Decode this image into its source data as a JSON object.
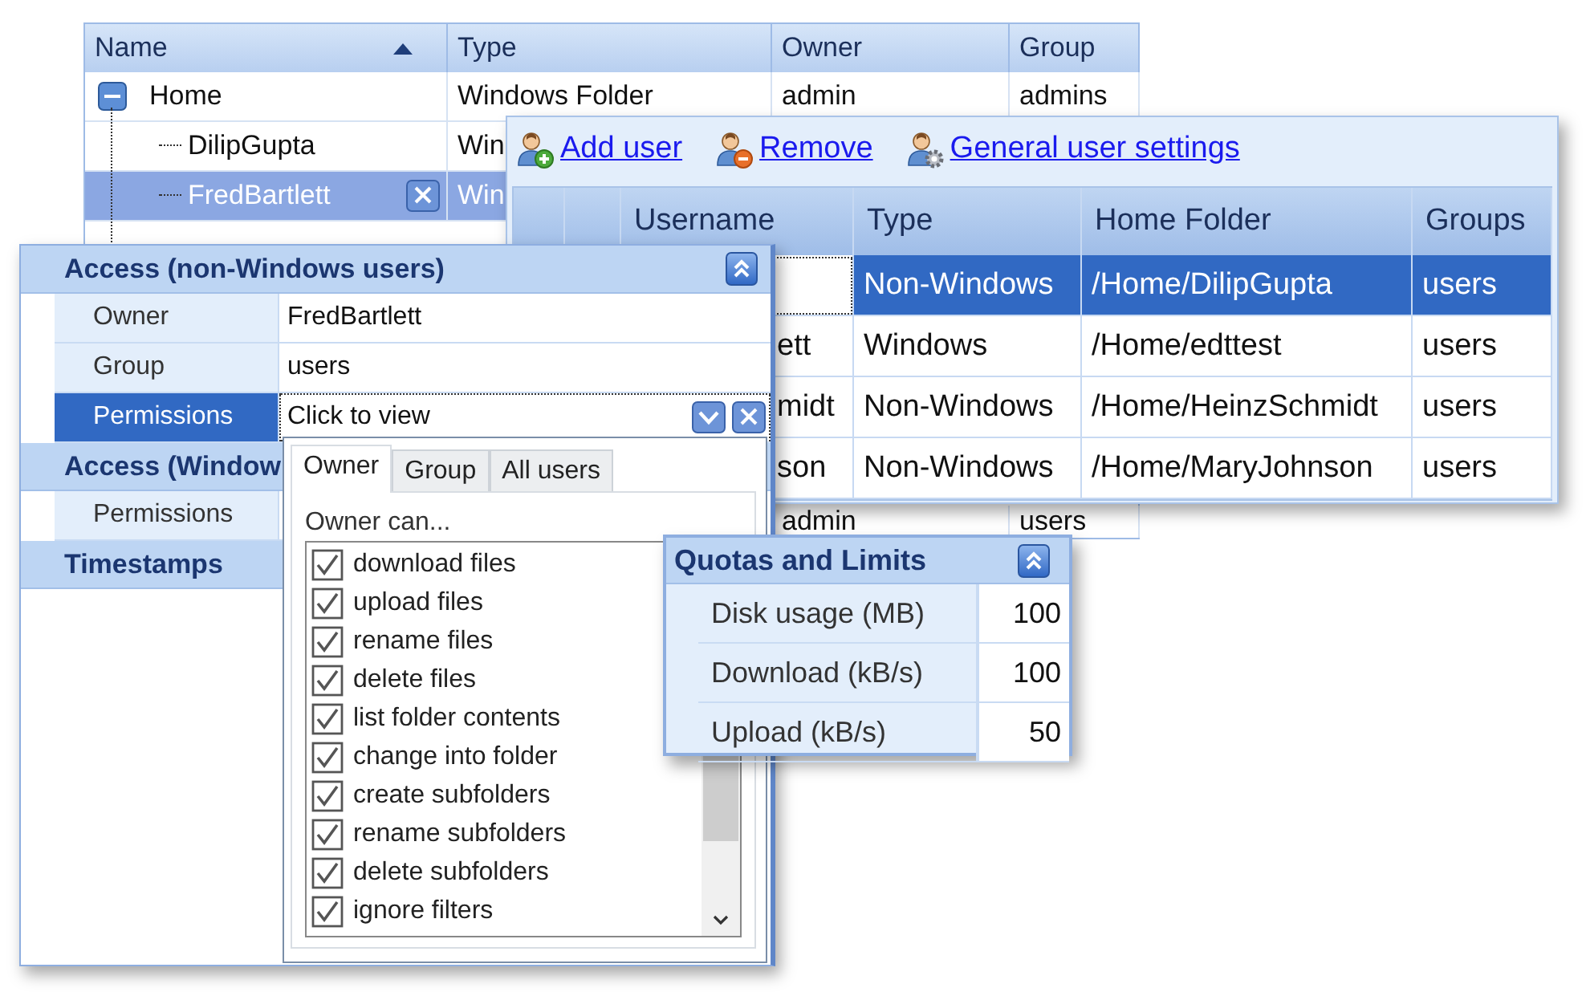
{
  "tree_grid": {
    "columns": [
      {
        "label": "Name",
        "sorted": true
      },
      {
        "label": "Type",
        "sorted": false
      },
      {
        "label": "Owner",
        "sorted": false
      },
      {
        "label": "Group",
        "sorted": false
      }
    ],
    "rows": [
      {
        "name": "Home",
        "type": "Windows Folder",
        "owner": "admin",
        "group": "admins",
        "expanded": true,
        "selected": false,
        "children": [
          {
            "name": "DilipGupta",
            "type": "Win",
            "selected": false
          },
          {
            "name": "FredBartlett",
            "type": "Win",
            "selected": true
          }
        ]
      }
    ],
    "lower_row": {
      "owner": "admin",
      "group": "users"
    }
  },
  "user_manager": {
    "toolbar": [
      {
        "label": "Add user",
        "kind": "add"
      },
      {
        "label": "Remove",
        "kind": "remove"
      },
      {
        "label": "General user settings",
        "kind": "settings"
      }
    ],
    "columns": [
      "Username",
      "Type",
      "Home Folder",
      "Groups"
    ],
    "rows": [
      {
        "type": "Non-Windows",
        "home_folder": "/Home/DilipGupta",
        "groups": "users",
        "selected": true
      },
      {
        "username": "ett",
        "type": "Windows",
        "home_folder": "/Home/edttest",
        "groups": "users",
        "selected": false
      },
      {
        "username": "midt",
        "type": "Non-Windows",
        "home_folder": "/Home/HeinzSchmidt",
        "groups": "users",
        "selected": false
      },
      {
        "username": "son",
        "type": "Non-Windows",
        "home_folder": "/Home/MaryJohnson",
        "groups": "users",
        "selected": false
      }
    ]
  },
  "properties": {
    "categories": [
      {
        "title": "Access (non-Windows users)",
        "expanded": true,
        "rows": [
          {
            "label": "Owner",
            "value": "FredBartlett",
            "kind": "text",
            "selected": false
          },
          {
            "label": "Group",
            "value": "users",
            "kind": "text",
            "selected": false
          },
          {
            "label": "Permissions",
            "value": "Click to view",
            "kind": "dropdown",
            "selected": true
          }
        ]
      },
      {
        "title": "Access (Window",
        "rows": [
          {
            "label": "Permissions",
            "kind": "text",
            "selected": false
          }
        ]
      },
      {
        "title": "Timestamps"
      }
    ]
  },
  "permissions_popup": {
    "tabs": [
      {
        "label": "Owner",
        "selected": true
      },
      {
        "label": "Group",
        "selected": false
      },
      {
        "label": "All users",
        "selected": false
      }
    ],
    "caption": "Owner can...",
    "items": [
      {
        "label": "download files",
        "checked": true
      },
      {
        "label": "upload files",
        "checked": true
      },
      {
        "label": "rename files",
        "checked": true
      },
      {
        "label": "delete files",
        "checked": true
      },
      {
        "label": "list folder contents",
        "checked": true
      },
      {
        "label": "change into folder",
        "checked": true
      },
      {
        "label": "create subfolders",
        "checked": true
      },
      {
        "label": "rename subfolders",
        "checked": true
      },
      {
        "label": "delete subfolders",
        "checked": true
      },
      {
        "label": "ignore filters",
        "checked": true
      }
    ]
  },
  "quotas": {
    "title": "Quotas and Limits",
    "expanded": true,
    "rows": [
      {
        "label": "Disk usage (MB)",
        "value": "100"
      },
      {
        "label": "Download (kB/s)",
        "value": "100"
      },
      {
        "label": "Upload (kB/s)",
        "value": "50"
      }
    ]
  }
}
